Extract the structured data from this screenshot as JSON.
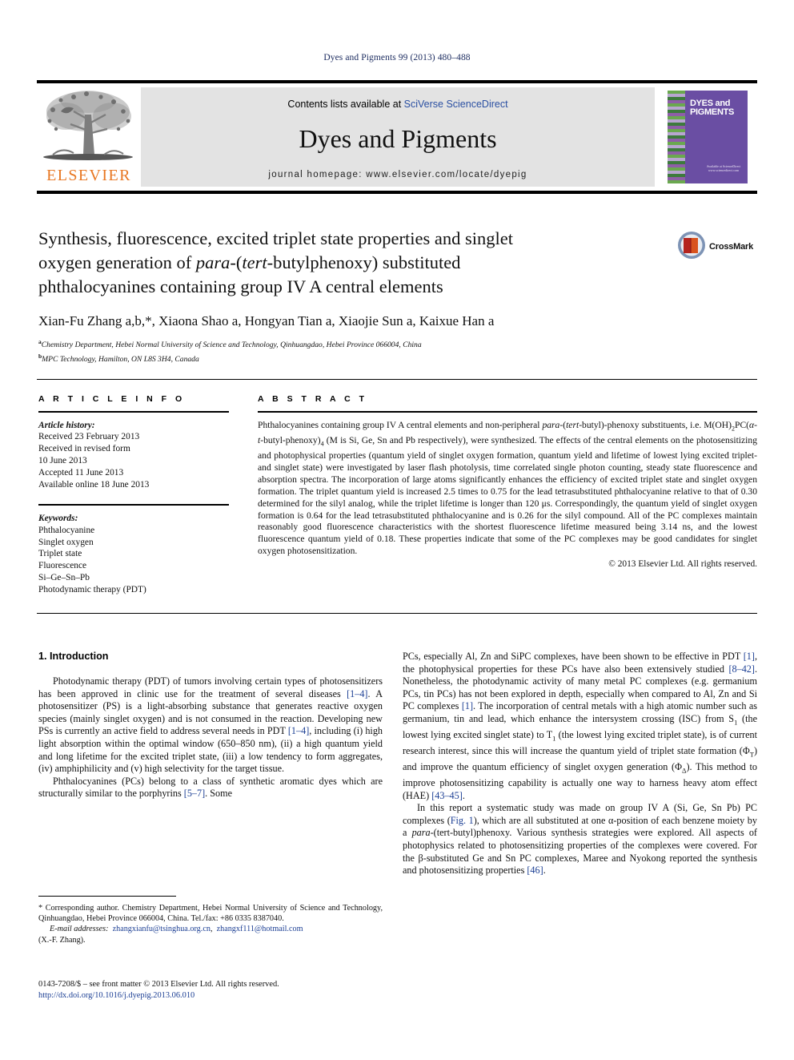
{
  "running_head": "Dyes and Pigments 99 (2013) 480–488",
  "masthead": {
    "publisher_logo_text": "ELSEVIER",
    "contents_prefix": "Contents lists available at ",
    "contents_link": "SciVerse ScienceDirect",
    "journal_title": "Dyes and Pigments",
    "homepage": "journal homepage: www.elsevier.com/locate/dyepig",
    "cover_title": "DYES and PIGMENTS",
    "cover_footer": "Available at ScienceDirect www.sciencedirect.com"
  },
  "article": {
    "title_line1": "Synthesis, fluorescence, excited triplet state properties and singlet",
    "title_line2_a": "oxygen generation of ",
    "title_line2_i1": "para",
    "title_line2_b": "-(",
    "title_line2_i2": "tert",
    "title_line2_c": "-butylphenoxy) substituted",
    "title_line3": "phthalocyanines containing group IV A central elements",
    "crossmark_label": "CrossMark",
    "authors_text": "Xian-Fu Zhang a,b,*, Xiaona Shao a, Hongyan Tian a, Xiaojie Sun a, Kaixue Han a",
    "affiliation_a": "Chemistry Department, Hebei Normal University of Science and Technology, Qinhuangdao, Hebei Province 066004, China",
    "affiliation_b": "MPC Technology, Hamilton, ON L8S 3H4, Canada"
  },
  "article_info": {
    "heading": "A R T I C L E   I N F O",
    "history_label": "Article history:",
    "history": [
      "Received 23 February 2013",
      "Received in revised form",
      "10 June 2013",
      "Accepted 11 June 2013",
      "Available online 18 June 2013"
    ],
    "keywords_label": "Keywords:",
    "keywords": [
      "Phthalocyanine",
      "Singlet oxygen",
      "Triplet state",
      "Fluorescence",
      "Si–Ge–Sn–Pb",
      "Photodynamic therapy (PDT)"
    ]
  },
  "abstract": {
    "heading": "A B S T R A C T",
    "p1_a": "Phthalocyanines containing group IV A central elements and non-peripheral ",
    "p1_i1": "para",
    "p1_b": "-(",
    "p1_i2": "tert",
    "p1_c": "-butyl)-phenoxy substituents, i.e. M(OH)",
    "p1_sub1": "2",
    "p1_d": "PC(",
    "p1_i3": "α-t",
    "p1_e": "-butyl-phenoxy)",
    "p1_sub2": "4",
    "p1_f": " (M is Si, Ge, Sn and Pb respectively), were synthesized. The effects of the central elements on the photosensitizing and photophysical properties (quantum yield of singlet oxygen formation, quantum yield and lifetime of lowest lying excited triplet- and singlet state) were investigated by laser flash photolysis, time correlated single photon counting, steady state fluorescence and absorption spectra. The incorporation of large atoms significantly enhances the efficiency of excited triplet state and singlet oxygen formation. The triplet quantum yield is increased 2.5 times to 0.75 for the lead tetrasubstituted phthalocyanine relative to that of 0.30 determined for the silyl analog, while the triplet lifetime is longer than 120 μs. Correspondingly, the quantum yield of singlet oxygen formation is 0.64 for the lead tetrasubstituted phthalocyanine and is 0.26 for the silyl compound. All of the PC complexes maintain reasonably good fluorescence characteristics with the shortest fluorescence lifetime measured being 3.14 ns, and the lowest fluorescence quantum yield of 0.18. These properties indicate that some of the PC complexes may be good candidates for singlet oxygen photosensitization.",
    "copyright": "© 2013 Elsevier Ltd. All rights reserved."
  },
  "body": {
    "intro_heading": "1. Introduction",
    "left_p1_a": "Photodynamic therapy (PDT) of tumors involving certain types of photosensitizers has been approved in clinic use for the treatment of several diseases ",
    "left_p1_ref1": "[1–4]",
    "left_p1_b": ". A photosensitizer (PS) is a light-absorbing substance that generates reactive oxygen species (mainly singlet oxygen) and is not consumed in the reaction. Developing new PSs is currently an active field to address several needs in PDT ",
    "left_p1_ref2": "[1–4]",
    "left_p1_c": ", including (i) high light absorption within the optimal window (650–850 nm), (ii) a high quantum yield and long lifetime for the excited triplet state, (iii) a low tendency to form aggregates, (iv) amphiphilicity and (v) high selectivity for the target tissue.",
    "left_p2_a": "Phthalocyanines (PCs) belong to a class of synthetic aromatic dyes which are structurally similar to the porphyrins ",
    "left_p2_ref": "[5–7]",
    "left_p2_b": ". Some",
    "right_p1_a": "PCs, especially Al, Zn and SiPC complexes, have been shown to be effective in PDT ",
    "right_p1_ref1": "[1]",
    "right_p1_b": ", the photophysical properties for these PCs have also been extensively studied ",
    "right_p1_ref2": "[8–42]",
    "right_p1_c": ". Nonetheless, the photodynamic activity of many metal PC complexes (e.g. germanium PCs, tin PCs) has not been explored in depth, especially when compared to Al, Zn and Si PC complexes ",
    "right_p1_ref3": "[1]",
    "right_p1_d": ". The incorporation of central metals with a high atomic number such as germanium, tin and lead, which enhance the intersystem crossing (ISC) from S",
    "right_p1_sub1": "1",
    "right_p1_e": " (the lowest lying excited singlet state) to T",
    "right_p1_sub2": "1",
    "right_p1_f": " (the lowest lying excited triplet state), is of current research interest, since this will increase the quantum yield of triplet state formation (Φ",
    "right_p1_sub3": "T",
    "right_p1_g": ") and improve the quantum efficiency of singlet oxygen generation (Φ",
    "right_p1_sub4": "Δ",
    "right_p1_h": "). This method to improve photosensitizing capability is actually one way to harness heavy atom effect (HAE) ",
    "right_p1_ref4": "[43–45]",
    "right_p1_i": ".",
    "right_p2_a": "In this report a systematic study was made on group IV A (Si, Ge, Sn Pb) PC complexes (",
    "right_p2_figref": "Fig. 1",
    "right_p2_b": "), which are all substituted at one α-position of each benzene moiety by a ",
    "right_p2_i1": "para",
    "right_p2_c": "-(tert-butyl)phenoxy. Various synthesis strategies were explored. All aspects of photophysics related to photosensitizing properties of the complexes were covered. For the β-substituted Ge and Sn PC complexes, Maree and Nyokong reported the synthesis and photosensitizing properties ",
    "right_p2_ref": "[46]",
    "right_p2_d": "."
  },
  "footnote": {
    "corr_a": "* Corresponding author. Chemistry Department, Hebei Normal University of Science and Technology, Qinhuangdao, Hebei Province 066004, China. Tel./fax: +86 0335 8387040.",
    "email_label": "E-mail addresses:",
    "email1": "zhangxianfu@tsinghua.org.cn",
    "email2": "zhangxf111@hotmail.com",
    "email_tail": "(X.-F. Zhang)."
  },
  "footer": {
    "front_matter": "0143-7208/$ – see front matter © 2013 Elsevier Ltd. All rights reserved.",
    "doi": "http://dx.doi.org/10.1016/j.dyepig.2013.06.010"
  },
  "colors": {
    "elsevier_orange": "#E87722",
    "link_blue": "#1c3f94",
    "header_navy": "#1a2a5e",
    "cover_purple": "#6a4ea3",
    "banner_grey": "#e3e3e3"
  }
}
